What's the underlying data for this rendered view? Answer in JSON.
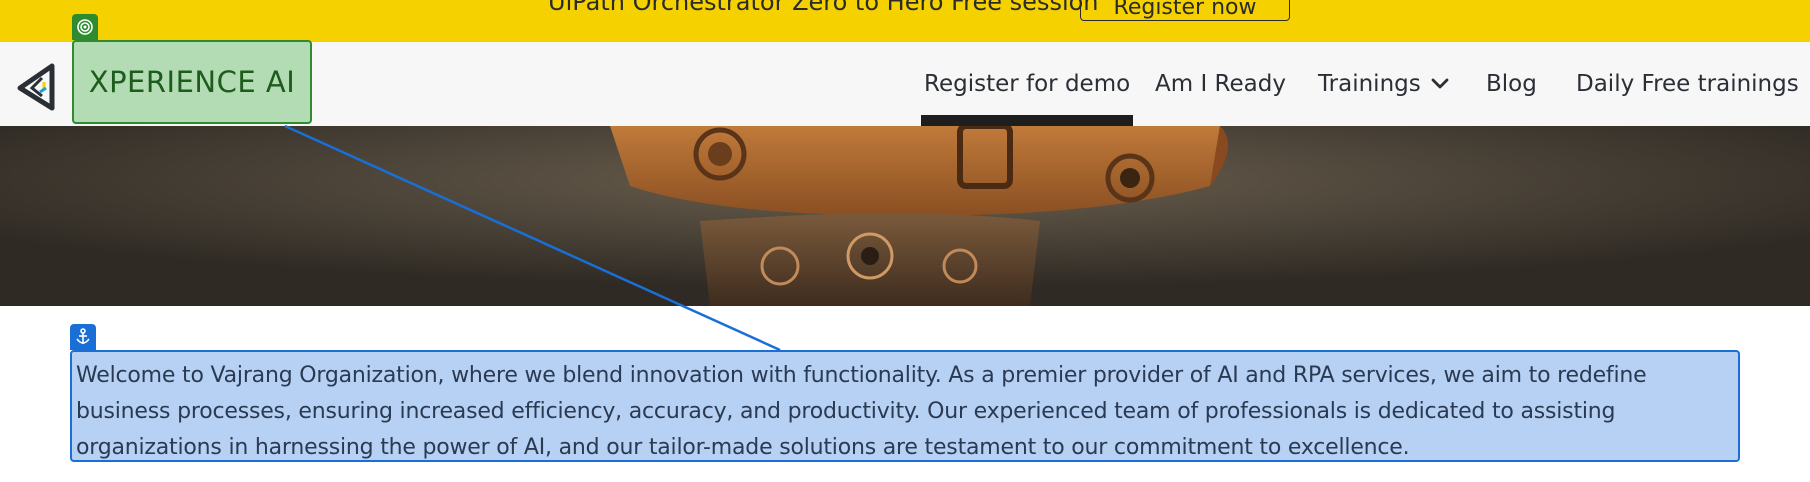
{
  "announcement": {
    "text": "UiPath Orchestrator Zero to Hero Free session",
    "cta_label": "Register now"
  },
  "header": {
    "brand": "XPERIENCE AI",
    "nav": [
      {
        "label": "Register for demo",
        "active": true
      },
      {
        "label": "Am I Ready",
        "active": false
      },
      {
        "label": "Trainings",
        "active": false,
        "has_dropdown": true
      },
      {
        "label": "Blog",
        "active": false
      },
      {
        "label": "Daily Free trainings",
        "active": false
      }
    ]
  },
  "hero": {
    "image": "robot-head-image"
  },
  "intro": {
    "text": "Welcome to Vajrang Organization, where we blend innovation with functionality. As a premier provider of AI and RPA services, we aim to redefine business processes, ensuring increased efficiency, accuracy, and productivity. Our experienced team of professionals is dedicated to assisting organizations in harnessing the power of AI, and our tailor-made solutions are testament to our commitment to excellence."
  },
  "colors": {
    "announcement_bg": "#f6d100",
    "brand_highlight": "#b3dcb4",
    "brand_border": "#2e8b2e",
    "intro_highlight": "#b7d1f5",
    "intro_border": "#1a6fd6"
  },
  "icons": {
    "logo": "triangle-logo-icon",
    "brand_badge": "target-icon",
    "intro_badge": "anchor-icon",
    "dropdown": "chevron-down-icon"
  }
}
